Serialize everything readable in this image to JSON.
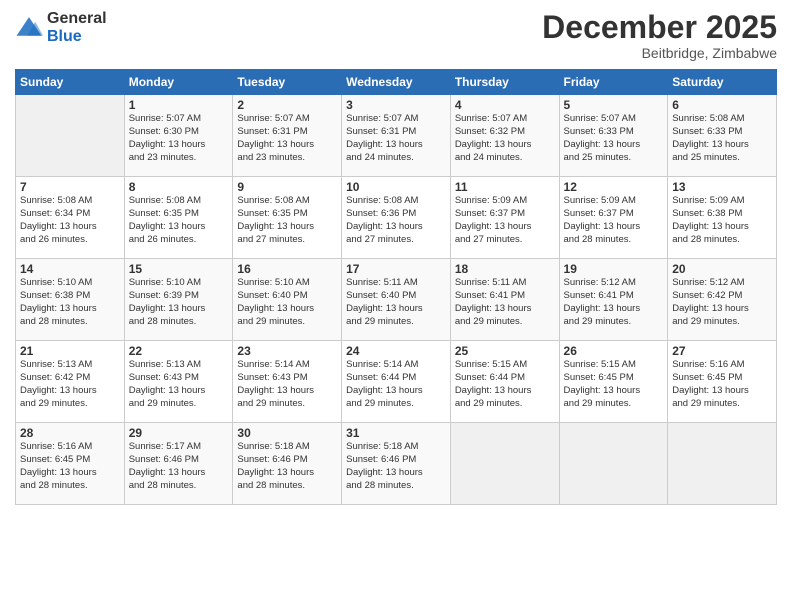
{
  "logo": {
    "general": "General",
    "blue": "Blue"
  },
  "title": "December 2025",
  "location": "Beitbridge, Zimbabwe",
  "days_header": [
    "Sunday",
    "Monday",
    "Tuesday",
    "Wednesday",
    "Thursday",
    "Friday",
    "Saturday"
  ],
  "weeks": [
    [
      {
        "day": "",
        "info": ""
      },
      {
        "day": "1",
        "info": "Sunrise: 5:07 AM\nSunset: 6:30 PM\nDaylight: 13 hours\nand 23 minutes."
      },
      {
        "day": "2",
        "info": "Sunrise: 5:07 AM\nSunset: 6:31 PM\nDaylight: 13 hours\nand 23 minutes."
      },
      {
        "day": "3",
        "info": "Sunrise: 5:07 AM\nSunset: 6:31 PM\nDaylight: 13 hours\nand 24 minutes."
      },
      {
        "day": "4",
        "info": "Sunrise: 5:07 AM\nSunset: 6:32 PM\nDaylight: 13 hours\nand 24 minutes."
      },
      {
        "day": "5",
        "info": "Sunrise: 5:07 AM\nSunset: 6:33 PM\nDaylight: 13 hours\nand 25 minutes."
      },
      {
        "day": "6",
        "info": "Sunrise: 5:08 AM\nSunset: 6:33 PM\nDaylight: 13 hours\nand 25 minutes."
      }
    ],
    [
      {
        "day": "7",
        "info": "Sunrise: 5:08 AM\nSunset: 6:34 PM\nDaylight: 13 hours\nand 26 minutes."
      },
      {
        "day": "8",
        "info": "Sunrise: 5:08 AM\nSunset: 6:35 PM\nDaylight: 13 hours\nand 26 minutes."
      },
      {
        "day": "9",
        "info": "Sunrise: 5:08 AM\nSunset: 6:35 PM\nDaylight: 13 hours\nand 27 minutes."
      },
      {
        "day": "10",
        "info": "Sunrise: 5:08 AM\nSunset: 6:36 PM\nDaylight: 13 hours\nand 27 minutes."
      },
      {
        "day": "11",
        "info": "Sunrise: 5:09 AM\nSunset: 6:37 PM\nDaylight: 13 hours\nand 27 minutes."
      },
      {
        "day": "12",
        "info": "Sunrise: 5:09 AM\nSunset: 6:37 PM\nDaylight: 13 hours\nand 28 minutes."
      },
      {
        "day": "13",
        "info": "Sunrise: 5:09 AM\nSunset: 6:38 PM\nDaylight: 13 hours\nand 28 minutes."
      }
    ],
    [
      {
        "day": "14",
        "info": "Sunrise: 5:10 AM\nSunset: 6:38 PM\nDaylight: 13 hours\nand 28 minutes."
      },
      {
        "day": "15",
        "info": "Sunrise: 5:10 AM\nSunset: 6:39 PM\nDaylight: 13 hours\nand 28 minutes."
      },
      {
        "day": "16",
        "info": "Sunrise: 5:10 AM\nSunset: 6:40 PM\nDaylight: 13 hours\nand 29 minutes."
      },
      {
        "day": "17",
        "info": "Sunrise: 5:11 AM\nSunset: 6:40 PM\nDaylight: 13 hours\nand 29 minutes."
      },
      {
        "day": "18",
        "info": "Sunrise: 5:11 AM\nSunset: 6:41 PM\nDaylight: 13 hours\nand 29 minutes."
      },
      {
        "day": "19",
        "info": "Sunrise: 5:12 AM\nSunset: 6:41 PM\nDaylight: 13 hours\nand 29 minutes."
      },
      {
        "day": "20",
        "info": "Sunrise: 5:12 AM\nSunset: 6:42 PM\nDaylight: 13 hours\nand 29 minutes."
      }
    ],
    [
      {
        "day": "21",
        "info": "Sunrise: 5:13 AM\nSunset: 6:42 PM\nDaylight: 13 hours\nand 29 minutes."
      },
      {
        "day": "22",
        "info": "Sunrise: 5:13 AM\nSunset: 6:43 PM\nDaylight: 13 hours\nand 29 minutes."
      },
      {
        "day": "23",
        "info": "Sunrise: 5:14 AM\nSunset: 6:43 PM\nDaylight: 13 hours\nand 29 minutes."
      },
      {
        "day": "24",
        "info": "Sunrise: 5:14 AM\nSunset: 6:44 PM\nDaylight: 13 hours\nand 29 minutes."
      },
      {
        "day": "25",
        "info": "Sunrise: 5:15 AM\nSunset: 6:44 PM\nDaylight: 13 hours\nand 29 minutes."
      },
      {
        "day": "26",
        "info": "Sunrise: 5:15 AM\nSunset: 6:45 PM\nDaylight: 13 hours\nand 29 minutes."
      },
      {
        "day": "27",
        "info": "Sunrise: 5:16 AM\nSunset: 6:45 PM\nDaylight: 13 hours\nand 29 minutes."
      }
    ],
    [
      {
        "day": "28",
        "info": "Sunrise: 5:16 AM\nSunset: 6:45 PM\nDaylight: 13 hours\nand 28 minutes."
      },
      {
        "day": "29",
        "info": "Sunrise: 5:17 AM\nSunset: 6:46 PM\nDaylight: 13 hours\nand 28 minutes."
      },
      {
        "day": "30",
        "info": "Sunrise: 5:18 AM\nSunset: 6:46 PM\nDaylight: 13 hours\nand 28 minutes."
      },
      {
        "day": "31",
        "info": "Sunrise: 5:18 AM\nSunset: 6:46 PM\nDaylight: 13 hours\nand 28 minutes."
      },
      {
        "day": "",
        "info": ""
      },
      {
        "day": "",
        "info": ""
      },
      {
        "day": "",
        "info": ""
      }
    ]
  ]
}
